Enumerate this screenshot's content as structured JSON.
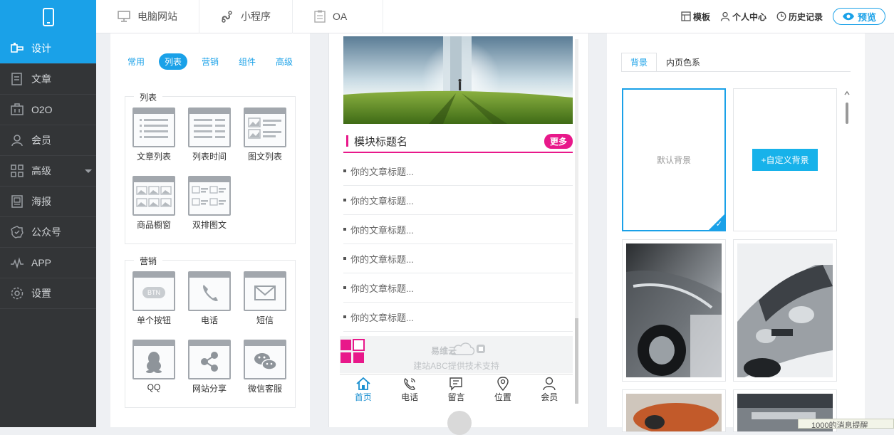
{
  "sidebar": {
    "items": [
      {
        "label": "设计",
        "icon": "design-icon"
      },
      {
        "label": "文章",
        "icon": "article-icon"
      },
      {
        "label": "O2O",
        "icon": "o2o-icon"
      },
      {
        "label": "会员",
        "icon": "member-icon"
      },
      {
        "label": "高级",
        "icon": "advanced-icon"
      },
      {
        "label": "海报",
        "icon": "poster-icon"
      },
      {
        "label": "公众号",
        "icon": "official-account-icon"
      },
      {
        "label": "APP",
        "icon": "app-icon"
      },
      {
        "label": "设置",
        "icon": "settings-icon"
      }
    ]
  },
  "topbar": {
    "tabs": [
      {
        "label": "电脑网站"
      },
      {
        "label": "小程序"
      },
      {
        "label": "OA"
      }
    ],
    "template": "模板",
    "profile": "个人中心",
    "history": "历史记录",
    "preview": "预览"
  },
  "components": {
    "tabs": [
      "常用",
      "列表",
      "营销",
      "组件",
      "高级"
    ],
    "list_group": {
      "title": "列表",
      "items": [
        "文章列表",
        "列表时间",
        "图文列表",
        "商品橱窗",
        "双排图文"
      ]
    },
    "marketing_group": {
      "title": "营销",
      "btn_text": "BTN",
      "items": [
        "单个按钮",
        "电话",
        "短信",
        "QQ",
        "网站分享",
        "微信客服"
      ]
    }
  },
  "phone": {
    "module_title": "模块标题名",
    "more": "更多",
    "articles": [
      "你的文章标题...",
      "你的文章标题...",
      "你的文章标题...",
      "你的文章标题...",
      "你的文章标题...",
      "你的文章标题..."
    ],
    "brand": "易维云",
    "support": "建站ABC提供技术支持",
    "tabbar": [
      "首页",
      "电话",
      "留言",
      "位置",
      "会员"
    ]
  },
  "right": {
    "tabs": [
      "背景",
      "内页色系"
    ],
    "default_bg": "默认背景",
    "custom_bg": "+自定义背景"
  },
  "notification": "1000的消息提醒"
}
